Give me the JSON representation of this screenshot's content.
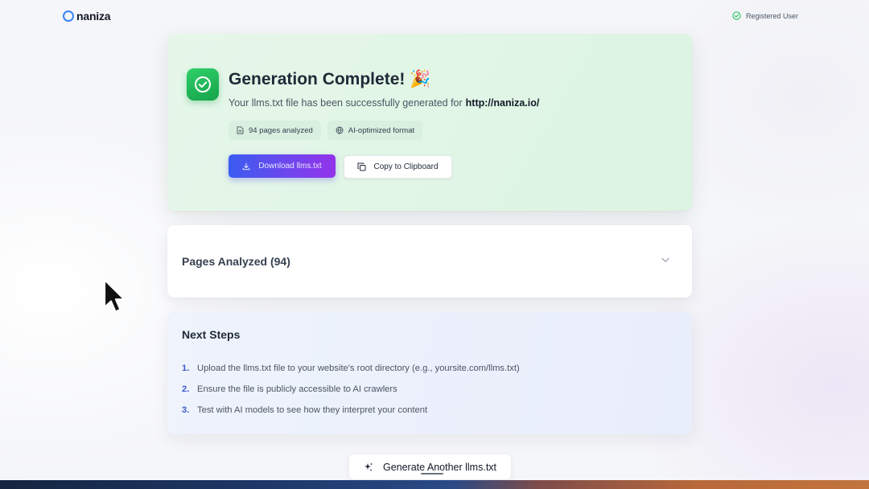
{
  "header": {
    "logo_text": "naniza",
    "user_label": "Registered User"
  },
  "success": {
    "title": "Generation Complete!",
    "title_emoji": "🎉",
    "description": "Your llms.txt file has been successfully generated for",
    "url": "http://naniza.io/",
    "meta": {
      "pages_label": "94 pages analyzed",
      "format_label": "AI-optimized format"
    },
    "download_label": "Download llms.txt",
    "copy_label": "Copy to Clipboard"
  },
  "pages_section": {
    "title": "Pages Analyzed (94)",
    "expanded": false
  },
  "next_steps": {
    "title": "Next Steps",
    "items": [
      {
        "num": "1.",
        "text": "Upload the llms.txt file to your website's root directory (e.g., yoursite.com/llms.txt)"
      },
      {
        "num": "2.",
        "text": "Ensure the file is publicly accessible to AI crawlers"
      },
      {
        "num": "3.",
        "text": "Test with AI models to see how they interpret your content"
      }
    ]
  },
  "generate_label": "Generate Another llms.txt",
  "icons": {
    "logo": "ring-logo-icon",
    "user": "check-circle-icon",
    "success": "check-circle-icon",
    "pages": "document-icon",
    "format": "globe-icon",
    "download": "download-icon",
    "copy": "copy-icon",
    "chevron": "chevron-down-icon",
    "generate": "sparkles-icon",
    "cursor": "mouse-pointer-icon"
  },
  "colors": {
    "brand_blue": "#3b82f6",
    "success_green": "#16a34a",
    "success_bg": "#e6f7ea",
    "primary_gradient_start": "#3b5cf0",
    "primary_gradient_end": "#9333ea",
    "steps_bg": "#eef3fc",
    "step_number": "#3b5cc9"
  }
}
